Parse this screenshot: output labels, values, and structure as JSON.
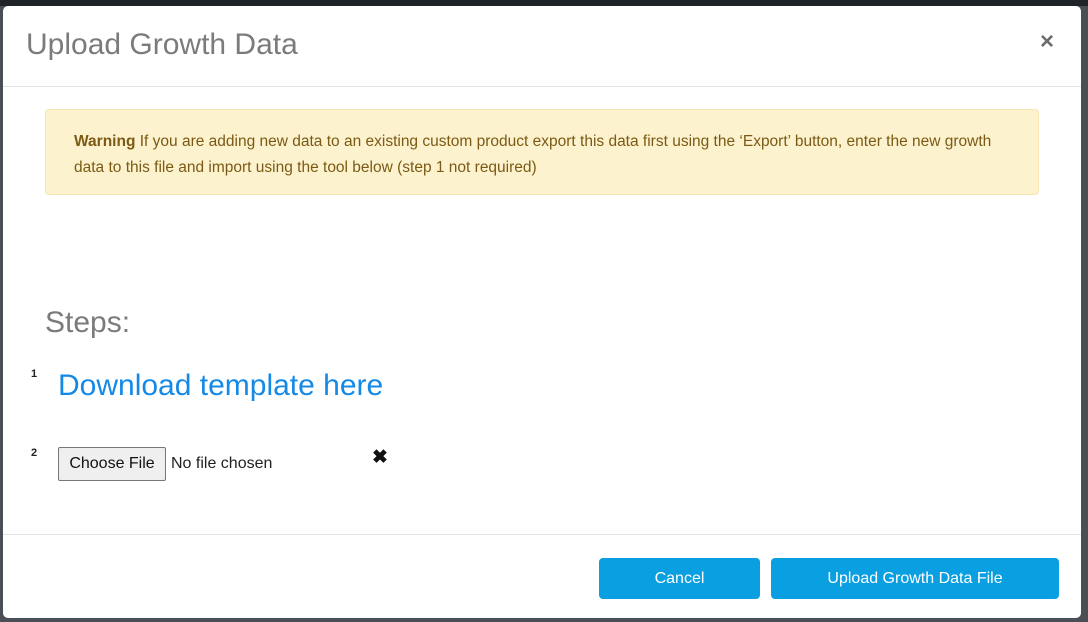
{
  "modal": {
    "title": "Upload Growth Data",
    "close_icon": "close-icon",
    "close_glyph": "×"
  },
  "warning": {
    "label": "Warning",
    "text": " If you are adding new data to an existing custom product export this data first using the ‘Export’ button, enter the new growth data to this file and import using the tool below (step 1 not required)",
    "colors": {
      "background": "#fdf2ce",
      "text": "#7a5a14"
    }
  },
  "steps": {
    "heading": "Steps:",
    "items": [
      {
        "number": "1",
        "link_text": "Download template here"
      },
      {
        "number": "2",
        "file_button_label": "Choose File",
        "file_status": "No file chosen",
        "clear_icon": "clear-file-icon",
        "clear_glyph": "✖"
      }
    ]
  },
  "footer": {
    "cancel_label": "Cancel",
    "upload_label": "Upload Growth Data File",
    "button_color": "#0a9fe1"
  }
}
